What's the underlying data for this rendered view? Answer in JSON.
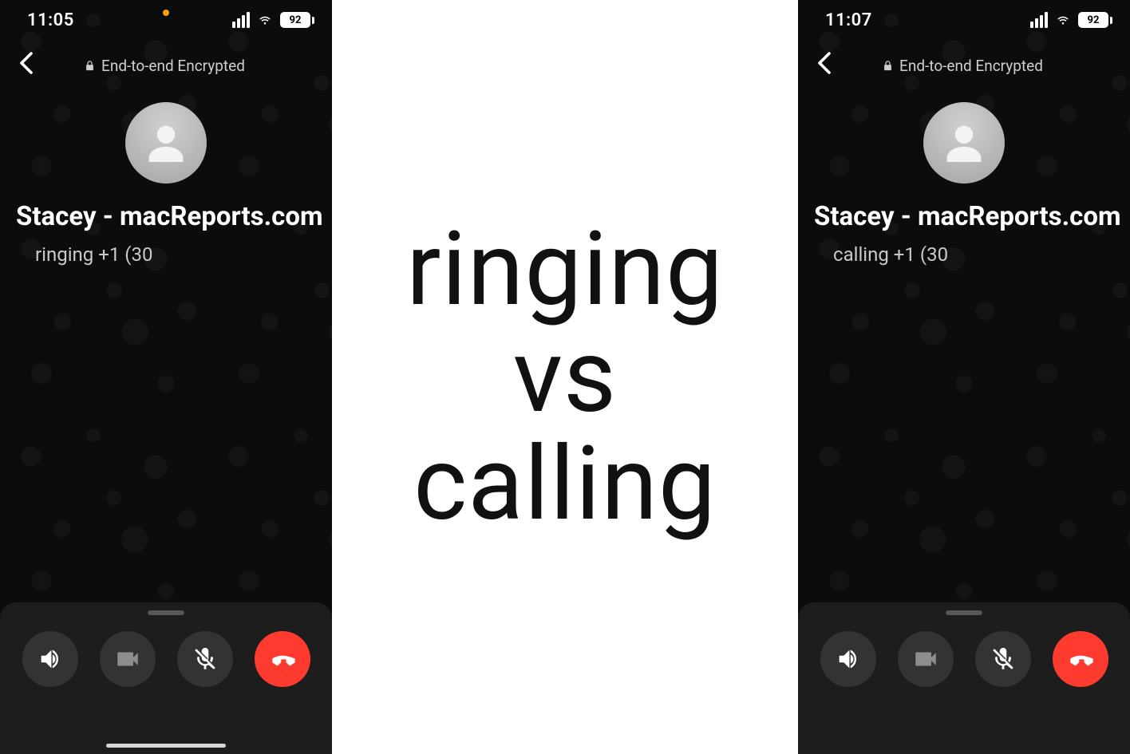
{
  "center": {
    "line1": "ringing",
    "line2": "vs",
    "line3": "calling"
  },
  "colors": {
    "end_call": "#ff3b30",
    "recording_dot": "#ff9f0a"
  },
  "left": {
    "status": {
      "time": "11:05",
      "battery": "92"
    },
    "encryption_label": "End-to-end Encrypted",
    "contact_name": "Stacey - macReports.com",
    "call_status": "ringing +1 (30"
  },
  "right": {
    "status": {
      "time": "11:07",
      "battery": "92"
    },
    "encryption_label": "End-to-end Encrypted",
    "contact_name": "Stacey - macReports.com",
    "call_status": "calling +1 (30"
  }
}
